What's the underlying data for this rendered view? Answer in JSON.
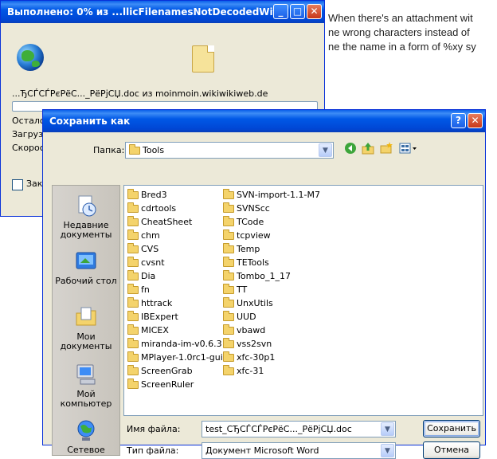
{
  "background_article": {
    "lines": [
      "When there's an attachment wit",
      "ne wrong characters instead of",
      "ne the name in a form of %xy sy"
    ]
  },
  "progress_window": {
    "title": "Выполнено: 0% из ...llicFilenamesNotDecodedWit...",
    "file_line": "...ЂСЃСЃРєРёС..._РёРјСЏ.doc из moinmoin.wikiwikiweb.de",
    "progress": 0,
    "labels": [
      "Остало",
      "Загрузи",
      "Скорос"
    ],
    "checkbox_label": "Закр"
  },
  "save_dialog": {
    "title": "Сохранить как",
    "folder_label": "Папка:",
    "folder_value": "Tools",
    "places": [
      {
        "label": "Недавние документы",
        "icon": "recent-documents-icon"
      },
      {
        "label": "Рабочий стол",
        "icon": "desktop-icon"
      },
      {
        "label": "Мои документы",
        "icon": "my-documents-icon"
      },
      {
        "label": "Мой компьютер",
        "icon": "my-computer-icon"
      },
      {
        "label": "Сетевое",
        "icon": "network-icon"
      }
    ],
    "folders_col1": [
      "Bred3",
      "cdrtools",
      "CheatSheet",
      "chm",
      "CVS",
      "cvsnt",
      "Dia",
      "fn",
      "httrack",
      "IBExpert",
      "MICEX",
      "miranda-im-v0.6.3",
      "MPlayer-1.0rc1-gui",
      "ScreenGrab",
      "ScreenRuler"
    ],
    "folders_col2": [
      "SVN-import-1.1-M7",
      "SVNScc",
      "TCode",
      "tcpview",
      "Temp",
      "TETools",
      "Tombo_1_17",
      "TT",
      "UnxUtils",
      "UUD",
      "vbawd",
      "vss2svn",
      "xfc-30p1",
      "xfc-31"
    ],
    "filename_label": "Имя файла:",
    "filename_value": "test_СЂСЃСЃРєРёС..._РёРјСЏ.doc",
    "filetype_label": "Тип файла:",
    "filetype_value": "Документ Microsoft Word",
    "save_button": "Сохранить",
    "cancel_button": "Отмена"
  }
}
